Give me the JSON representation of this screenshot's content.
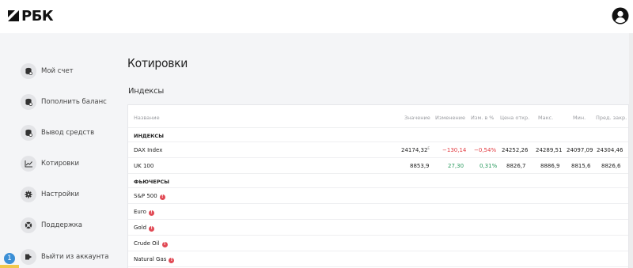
{
  "header": {
    "logo_text": "РБК",
    "user_icon": "user-circle-icon"
  },
  "sidebar": {
    "items": [
      {
        "label": "Мой счет",
        "icon": "coins-icon"
      },
      {
        "label": "Пополнить баланс",
        "icon": "coins-plus-icon"
      },
      {
        "label": "Вывод средств",
        "icon": "coins-withdraw-icon"
      },
      {
        "label": "Котировки",
        "icon": "chart-icon"
      },
      {
        "label": "Настройки",
        "icon": "gear-icon"
      },
      {
        "label": "Поддержка",
        "icon": "support-icon"
      },
      {
        "label": "Выйти из аккаунта",
        "icon": "logout-icon"
      }
    ],
    "badge": "1"
  },
  "main": {
    "title": "Котировки",
    "section": "Индексы",
    "columns": {
      "name": "Название",
      "value": "Значение",
      "change": "Изменение",
      "change_pct": "Изм. в %",
      "open": "Цена откр.",
      "max": "Макс.",
      "min": "Мин.",
      "prev_close": "Пред. закр."
    },
    "groups": {
      "indices": "ИНДЕКСЫ",
      "futures": "ФЬЮЧЕРСЫ"
    },
    "indices": [
      {
        "name": "DAX Index",
        "value": "24174,32",
        "value_sup": "E",
        "change": "−130,14",
        "change_pct": "−0,54%",
        "open": "24252,26",
        "max": "24289,51",
        "min": "24097,09",
        "prev_close": "24304,46"
      },
      {
        "name": "UK 100",
        "value": "8853,9",
        "change": "27,30",
        "change_pct": "0,31%",
        "open": "8826,7",
        "max": "8886,9",
        "min": "8815,6",
        "prev_close": "8826,6"
      }
    ],
    "futures": [
      {
        "name": "S&P 500",
        "info_icon": "info-icon"
      },
      {
        "name": "Euro",
        "info_icon": "info-icon"
      },
      {
        "name": "Gold",
        "info_icon": "info-icon"
      },
      {
        "name": "Crude Oil",
        "info_icon": "info-icon"
      },
      {
        "name": "Natural Gas",
        "info_icon": "info-icon"
      }
    ],
    "colors": {
      "negative": "#e2393f",
      "positive": "#2a9a5e",
      "info": "#e14a55",
      "badge": "#3b8fd6"
    }
  }
}
